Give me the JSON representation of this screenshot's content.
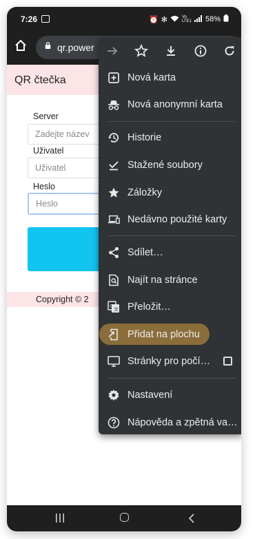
{
  "status_bar": {
    "time": "7:26",
    "network": "Vo LTE1",
    "battery": "58%"
  },
  "browser": {
    "url": "qr.power"
  },
  "app": {
    "title": "QR čtečka",
    "server_label": "Server",
    "server_placeholder": "Zadejte název",
    "user_label": "Uživatel",
    "user_placeholder": "Uživatel",
    "password_label": "Heslo",
    "password_placeholder": "Heslo",
    "footer_text": "Copyright © 2",
    "accent_color": "#12c5f0",
    "header_color": "#fde4e6"
  },
  "menu": {
    "toolbar": [
      "forward-icon",
      "bookmark-star-icon",
      "download-icon",
      "info-icon",
      "reload-icon"
    ],
    "items": [
      {
        "label": "Nová karta",
        "icon": "new-tab-icon"
      },
      {
        "label": "Nová anonymní karta",
        "icon": "incognito-icon"
      },
      {
        "label": "Historie",
        "icon": "history-icon"
      },
      {
        "label": "Stažené soubory",
        "icon": "downloads-icon"
      },
      {
        "label": "Záložky",
        "icon": "star-icon"
      },
      {
        "label": "Nedávno použité karty",
        "icon": "recent-tabs-icon"
      },
      {
        "label": "Sdílet…",
        "icon": "share-icon"
      },
      {
        "label": "Najít na stránce",
        "icon": "find-in-page-icon"
      },
      {
        "label": "Přeložit…",
        "icon": "translate-icon"
      },
      {
        "label": "Přidat na plochu",
        "icon": "add-to-home-icon"
      },
      {
        "label": "Stránky pro počí…",
        "icon": "desktop-site-icon"
      },
      {
        "label": "Nastavení",
        "icon": "settings-icon"
      },
      {
        "label": "Nápověda a zpětná va…",
        "icon": "help-icon"
      }
    ],
    "highlight_color": "#8b6d3b"
  }
}
